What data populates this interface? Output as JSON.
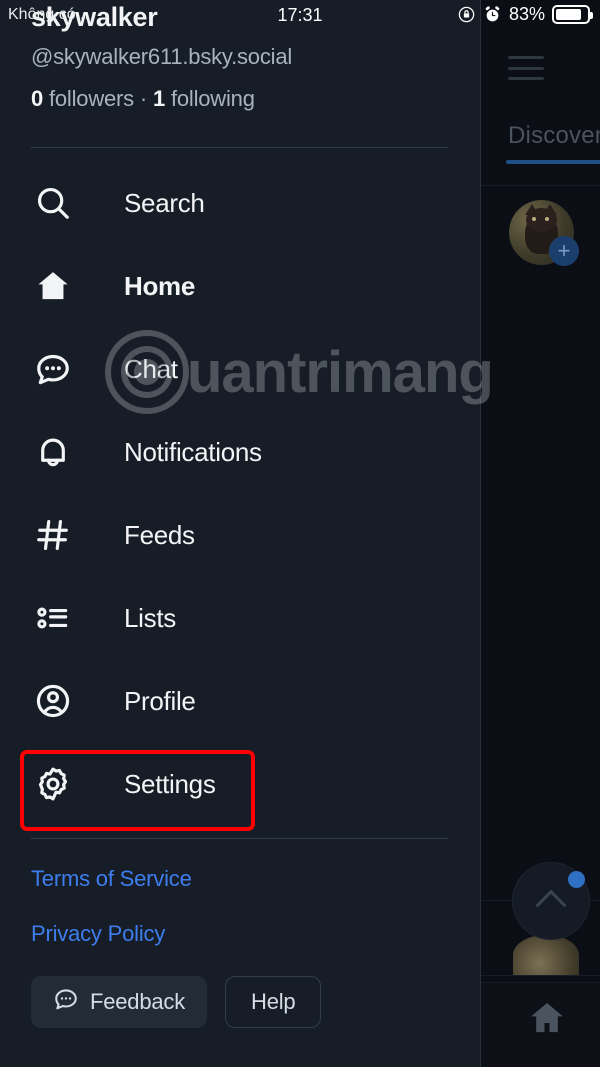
{
  "statusbar": {
    "carrier": "Không có...",
    "time": "17:31",
    "battery_percent": "83%",
    "rotation_lock_icon": "rotation-lock-icon",
    "alarm_icon": "alarm-clock-icon",
    "battery_icon": "battery-icon"
  },
  "drawer": {
    "profile": {
      "display_name": "skywalker",
      "handle": "@skywalker611.bsky.social",
      "followers_count": "0",
      "followers_label": "followers",
      "separator": "·",
      "following_count": "1",
      "following_label": "following"
    },
    "nav_items": [
      {
        "label": "Search",
        "icon": "search-icon",
        "active": false
      },
      {
        "label": "Home",
        "icon": "home-icon",
        "active": true
      },
      {
        "label": "Chat",
        "icon": "chat-bubble-icon",
        "active": false
      },
      {
        "label": "Notifications",
        "icon": "bell-icon",
        "active": false
      },
      {
        "label": "Feeds",
        "icon": "hashtag-icon",
        "active": false
      },
      {
        "label": "Lists",
        "icon": "list-icon",
        "active": false
      },
      {
        "label": "Profile",
        "icon": "person-circle-icon",
        "active": false
      },
      {
        "label": "Settings",
        "icon": "gear-icon",
        "active": false
      }
    ],
    "footer": {
      "terms_link": "Terms of Service",
      "privacy_link": "Privacy Policy",
      "feedback_button": "Feedback",
      "feedback_icon": "chat-bubble-icon",
      "help_button": "Help"
    }
  },
  "background_panel": {
    "menu_icon": "hamburger-menu-icon",
    "tab_label": "Discover",
    "avatar_icon": "cat-avatar",
    "follow_badge_icon": "plus-icon",
    "scroll_top_icon": "chevron-up-icon",
    "home_tab_icon": "home-icon"
  },
  "annotation": {
    "highlight_target": "Settings",
    "highlight_color": "#fe0000"
  },
  "watermark": {
    "text": "uantrimang",
    "logo_icon": "quantrimang-logo"
  },
  "colors": {
    "drawer_bg": "#161d26",
    "app_bg": "#0b0f15",
    "link_blue": "#3d7ded",
    "text_primary": "#f2f4f6",
    "text_secondary": "#aab2bd",
    "accent_blue": "#1f4f86"
  }
}
